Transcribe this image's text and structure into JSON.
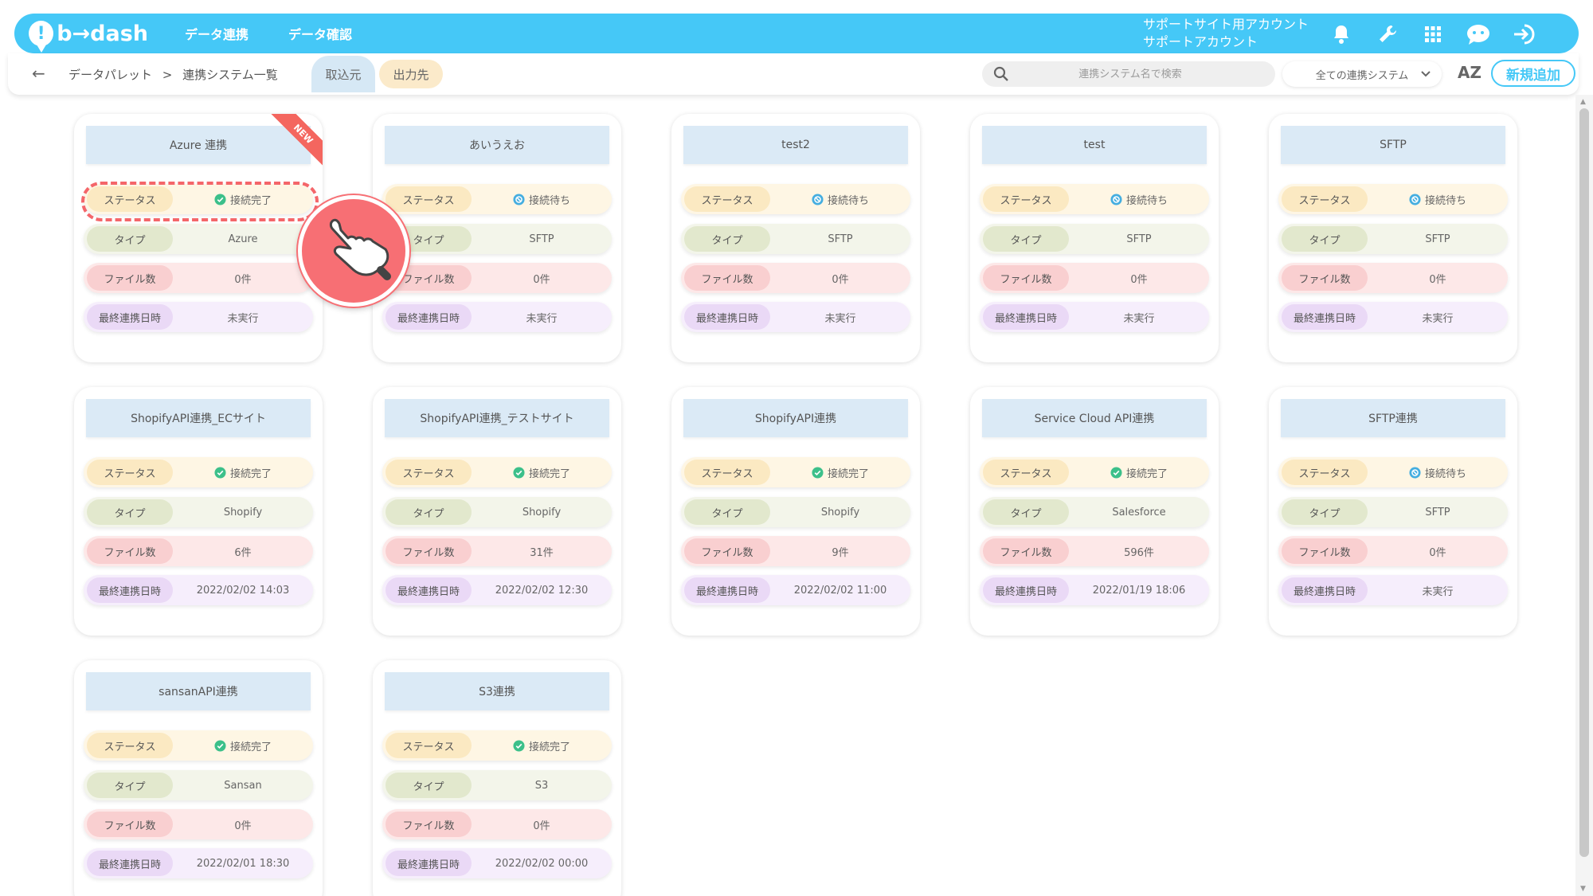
{
  "header": {
    "logo_icon_char": "!",
    "logo_text": "b→dash",
    "nav": [
      "データ連携",
      "データ確認"
    ],
    "account_line1": "サポートサイト用アカウント",
    "account_line2": "サポートアカウント",
    "icons": [
      "bell-icon",
      "wrench-icon",
      "grid-icon",
      "help-chat-icon",
      "logout-icon"
    ],
    "accent_color": "#45c8f7"
  },
  "subbar": {
    "back_symbol": "←",
    "breadcrumb_root": "データパレット",
    "breadcrumb_sep": ">",
    "breadcrumb_current": "連携システム一覧",
    "tab_import": "取込元",
    "tab_export": "出力先",
    "search_placeholder": "連携システム名で検索",
    "filter_value": "全ての連携システム",
    "sort_label": "AZ",
    "new_button": "新規追加"
  },
  "labels": {
    "status": "ステータス",
    "type": "タイプ",
    "files": "ファイル数",
    "last_run": "最終連携日時"
  },
  "new_badge": "NEW",
  "cards": [
    {
      "title": "Azure 連携",
      "status": "接続完了",
      "status_kind": "done",
      "type": "Azure",
      "files": "0件",
      "last": "未実行",
      "is_new": true
    },
    {
      "title": "あいうえお",
      "status": "接続待ち",
      "status_kind": "wait",
      "type": "SFTP",
      "files": "0件",
      "last": "未実行"
    },
    {
      "title": "test2",
      "status": "接続待ち",
      "status_kind": "wait",
      "type": "SFTP",
      "files": "0件",
      "last": "未実行"
    },
    {
      "title": "test",
      "status": "接続待ち",
      "status_kind": "wait",
      "type": "SFTP",
      "files": "0件",
      "last": "未実行"
    },
    {
      "title": "SFTP",
      "status": "接続待ち",
      "status_kind": "wait",
      "type": "SFTP",
      "files": "0件",
      "last": "未実行"
    },
    {
      "title": "ShopifyAPI連携_ECサイト",
      "status": "接続完了",
      "status_kind": "done",
      "type": "Shopify",
      "files": "6件",
      "last": "2022/02/02 14:03"
    },
    {
      "title": "ShopifyAPI連携_テストサイト",
      "status": "接続完了",
      "status_kind": "done",
      "type": "Shopify",
      "files": "31件",
      "last": "2022/02/02 12:30"
    },
    {
      "title": "ShopifyAPI連携",
      "status": "接続完了",
      "status_kind": "done",
      "type": "Shopify",
      "files": "9件",
      "last": "2022/02/02 11:00"
    },
    {
      "title": "Service Cloud API連携",
      "status": "接続完了",
      "status_kind": "done",
      "type": "Salesforce",
      "files": "596件",
      "last": "2022/01/19 18:06"
    },
    {
      "title": "SFTP連携",
      "status": "接続待ち",
      "status_kind": "wait",
      "type": "SFTP",
      "files": "0件",
      "last": "未実行"
    },
    {
      "title": "sansanAPI連携",
      "status": "接続完了",
      "status_kind": "done",
      "type": "Sansan",
      "files": "0件",
      "last": "2022/02/01 18:30"
    },
    {
      "title": "S3連携",
      "status": "接続完了",
      "status_kind": "done",
      "type": "S3",
      "files": "0件",
      "last": "2022/02/02 00:00"
    }
  ],
  "status_colors": {
    "done": "#3cc08a",
    "wait": "#45aee0"
  },
  "overlay": {
    "highlight_color": "#f4666a",
    "pointer_icon": "pointing-hand-icon"
  }
}
